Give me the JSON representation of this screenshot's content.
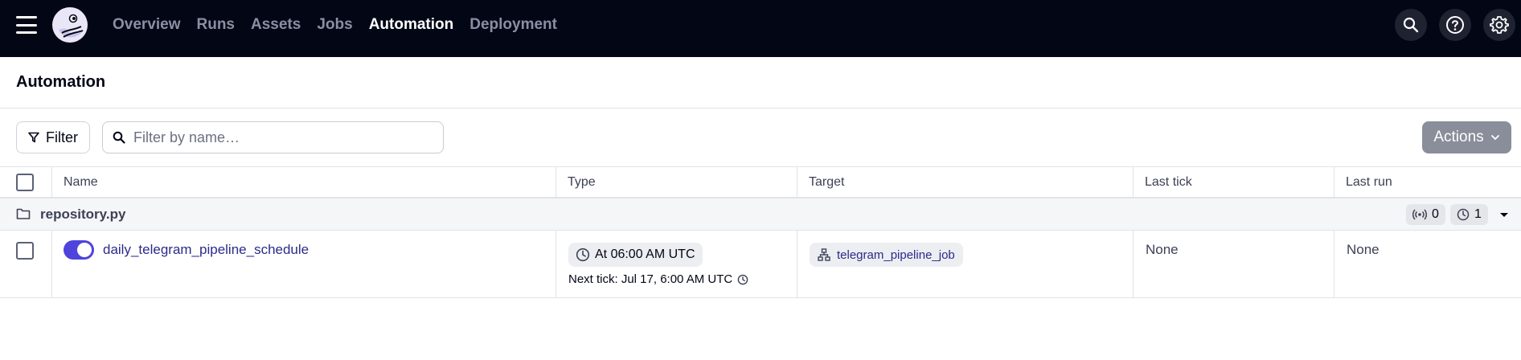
{
  "nav": {
    "items": [
      {
        "label": "Overview",
        "active": false
      },
      {
        "label": "Runs",
        "active": false
      },
      {
        "label": "Assets",
        "active": false
      },
      {
        "label": "Jobs",
        "active": false
      },
      {
        "label": "Automation",
        "active": true
      },
      {
        "label": "Deployment",
        "active": false
      }
    ],
    "icons": [
      "search-icon",
      "help-icon",
      "gear-icon"
    ]
  },
  "page": {
    "title": "Automation"
  },
  "toolbar": {
    "filter_label": "Filter",
    "search_placeholder": "Filter by name…",
    "search_value": "",
    "actions_label": "Actions"
  },
  "table": {
    "columns": [
      "Name",
      "Type",
      "Target",
      "Last tick",
      "Last run"
    ],
    "group": {
      "name": "repository.py",
      "sensor_count": "0",
      "schedule_count": "1"
    },
    "rows": [
      {
        "enabled": true,
        "name": "daily_telegram_pipeline_schedule",
        "type": "At 06:00 AM UTC",
        "next_tick": "Next tick: Jul 17, 6:00 AM UTC",
        "target": "telegram_pipeline_job",
        "last_tick": "None",
        "last_run": "None"
      }
    ]
  },
  "colors": {
    "topbar": "#030615",
    "accent": "#4f43dd",
    "link": "#2c2a8a",
    "actions_button": "#8a8e9a"
  }
}
